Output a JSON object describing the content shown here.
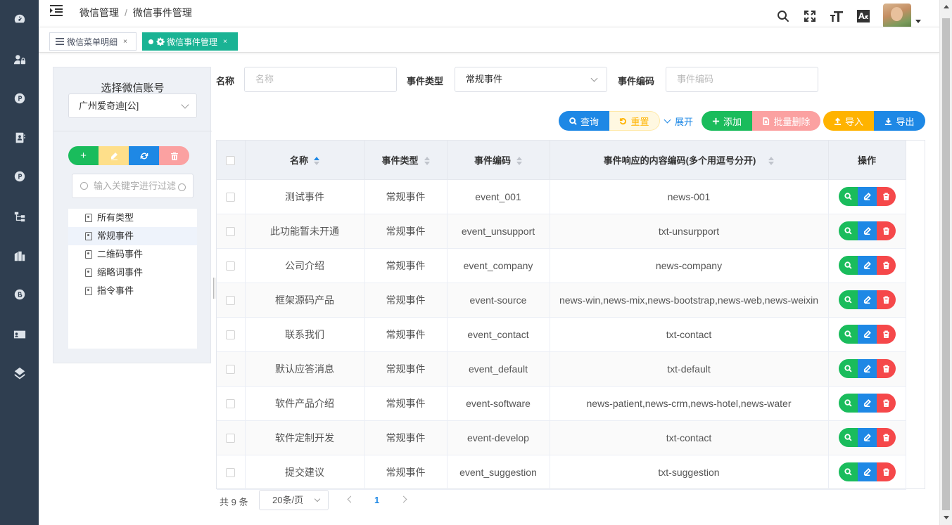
{
  "breadcrumb": {
    "root": "微信管理",
    "sep": "/",
    "current": "微信事件管理"
  },
  "tabs": [
    {
      "label": "微信菜单明细",
      "close": "×"
    },
    {
      "label": "微信事件管理",
      "close": "×"
    }
  ],
  "left_panel": {
    "title": "选择微信账号",
    "account": "广州爱奇迪[公]",
    "toolbar": {
      "add": "+"
    },
    "keyword_placeholder": "输入关键字进行过滤",
    "tree": [
      "所有类型",
      "常规事件",
      "二维码事件",
      "缩略词事件",
      "指令事件"
    ]
  },
  "search": {
    "name_label": "名称",
    "name_placeholder": "名称",
    "type_label": "事件类型",
    "type_value": "常规事件",
    "code_label": "事件编码",
    "code_placeholder": "事件编码"
  },
  "actions": {
    "query": "查询",
    "reset": "重置",
    "expand": "展开",
    "add": "添加",
    "batch_delete": "批量删除",
    "import": "导入",
    "export": "导出"
  },
  "colors": {
    "primary": "#1e88e5",
    "success": "#1abc5c",
    "danger": "#f5484a",
    "warning": "#ffb300",
    "tab_active": "#1ab394",
    "sidebar": "#2f3e50"
  },
  "table": {
    "headers": [
      "名称",
      "事件类型",
      "事件编码",
      "事件响应的内容编码(多个用逗号分开)",
      "操作"
    ],
    "rows": [
      [
        "测试事件",
        "常规事件",
        "event_001",
        "news-001"
      ],
      [
        "此功能暂未开通",
        "常规事件",
        "event_unsupport",
        "txt-unsurpport"
      ],
      [
        "公司介绍",
        "常规事件",
        "event_company",
        "news-company"
      ],
      [
        "框架源码产品",
        "常规事件",
        "event-source",
        "news-win,news-mix,news-bootstrap,news-web,news-weixin"
      ],
      [
        "联系我们",
        "常规事件",
        "event_contact",
        "txt-contact"
      ],
      [
        "默认应答消息",
        "常规事件",
        "event_default",
        "txt-default"
      ],
      [
        "软件产品介绍",
        "常规事件",
        "event-software",
        "news-patient,news-crm,news-hotel,news-water"
      ],
      [
        "软件定制开发",
        "常规事件",
        "event-develop",
        "txt-contact"
      ],
      [
        "提交建议",
        "常规事件",
        "event_suggestion",
        "txt-suggestion"
      ]
    ]
  },
  "pagination": {
    "total": "共 9 条",
    "page_size": "20条/页",
    "current_page": "1"
  }
}
